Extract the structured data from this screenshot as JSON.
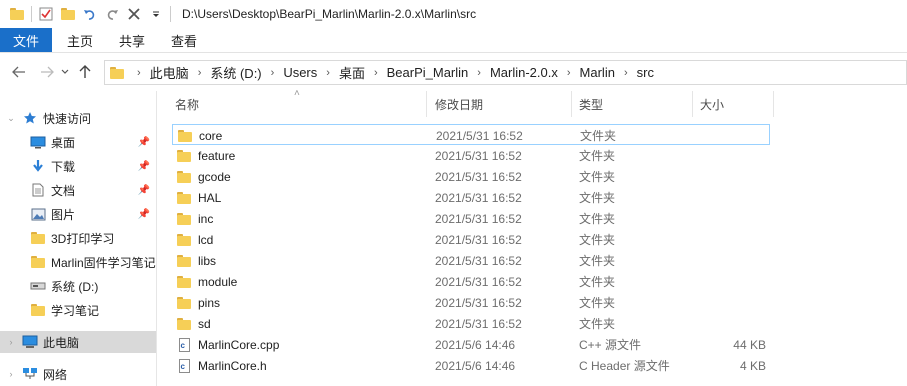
{
  "window": {
    "title_path": "D:\\Users\\Desktop\\BearPi_Marlin\\Marlin-2.0.x\\Marlin\\src"
  },
  "quick_access_toolbar": [
    "folder-icon",
    "properties-icon",
    "new-folder-icon",
    "undo-icon",
    "redo-icon",
    "delete-icon",
    "customize-dropdown-icon"
  ],
  "ribbon": {
    "tabs": [
      "文件",
      "主页",
      "共享",
      "查看"
    ]
  },
  "address": {
    "breadcrumbs": [
      "此电脑",
      "系统 (D:)",
      "Users",
      "桌面",
      "BearPi_Marlin",
      "Marlin-2.0.x",
      "Marlin",
      "src"
    ]
  },
  "sidebar": {
    "items": [
      {
        "label": "快速访问",
        "icon": "star-icon",
        "expander": "⌄",
        "pinned": false
      },
      {
        "label": "桌面",
        "icon": "desktop-icon",
        "expander": "",
        "pinned": true
      },
      {
        "label": "下载",
        "icon": "download-icon",
        "expander": "",
        "pinned": true
      },
      {
        "label": "文档",
        "icon": "document-icon",
        "expander": "",
        "pinned": true
      },
      {
        "label": "图片",
        "icon": "pictures-icon",
        "expander": "",
        "pinned": true
      },
      {
        "label": "3D打印学习",
        "icon": "folder-icon",
        "expander": "",
        "pinned": false
      },
      {
        "label": "Marlin固件学习笔记",
        "icon": "folder-icon",
        "expander": "",
        "pinned": false
      },
      {
        "label": "系统 (D:)",
        "icon": "drive-icon",
        "expander": "",
        "pinned": false
      },
      {
        "label": "学习笔记",
        "icon": "folder-icon",
        "expander": "",
        "pinned": false
      },
      {
        "label": "此电脑",
        "icon": "computer-icon",
        "expander": "›",
        "pinned": false
      },
      {
        "label": "网络",
        "icon": "network-icon",
        "expander": "›",
        "pinned": false
      }
    ]
  },
  "columns": {
    "name": "名称",
    "date": "修改日期",
    "type": "类型",
    "size": "大小"
  },
  "files": [
    {
      "name": "core",
      "date": "2021/5/31 16:52",
      "type": "文件夹",
      "size": "",
      "kind": "folder"
    },
    {
      "name": "feature",
      "date": "2021/5/31 16:52",
      "type": "文件夹",
      "size": "",
      "kind": "folder"
    },
    {
      "name": "gcode",
      "date": "2021/5/31 16:52",
      "type": "文件夹",
      "size": "",
      "kind": "folder"
    },
    {
      "name": "HAL",
      "date": "2021/5/31 16:52",
      "type": "文件夹",
      "size": "",
      "kind": "folder"
    },
    {
      "name": "inc",
      "date": "2021/5/31 16:52",
      "type": "文件夹",
      "size": "",
      "kind": "folder"
    },
    {
      "name": "lcd",
      "date": "2021/5/31 16:52",
      "type": "文件夹",
      "size": "",
      "kind": "folder"
    },
    {
      "name": "libs",
      "date": "2021/5/31 16:52",
      "type": "文件夹",
      "size": "",
      "kind": "folder"
    },
    {
      "name": "module",
      "date": "2021/5/31 16:52",
      "type": "文件夹",
      "size": "",
      "kind": "folder"
    },
    {
      "name": "pins",
      "date": "2021/5/31 16:52",
      "type": "文件夹",
      "size": "",
      "kind": "folder"
    },
    {
      "name": "sd",
      "date": "2021/5/31 16:52",
      "type": "文件夹",
      "size": "",
      "kind": "folder"
    },
    {
      "name": "MarlinCore.cpp",
      "date": "2021/5/6 14:46",
      "type": "C++ 源文件",
      "size": "44 KB",
      "kind": "file"
    },
    {
      "name": "MarlinCore.h",
      "date": "2021/5/6 14:46",
      "type": "C Header 源文件",
      "size": "4 KB",
      "kind": "file"
    }
  ],
  "colors": {
    "file_tab": "#1a6fc9",
    "folder": "#f6cf57",
    "focus_border": "#99d1ff",
    "selected_nav": "#d9d9d9"
  }
}
